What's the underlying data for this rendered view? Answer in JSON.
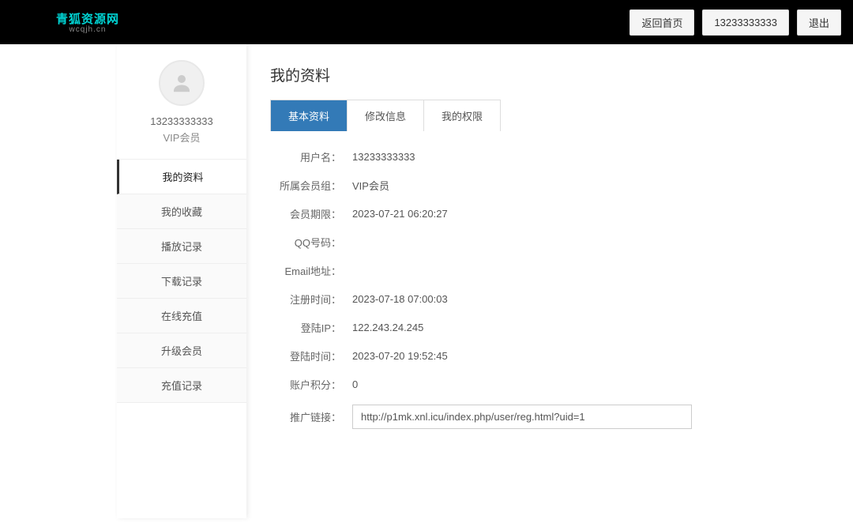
{
  "header": {
    "logo_top": "青狐资源网",
    "logo_bottom": "wcqjh.cn",
    "buttons": {
      "home": "返回首页",
      "user": "13233333333",
      "logout": "退出"
    }
  },
  "sidebar": {
    "username": "13233333333",
    "user_level": "VIP会员",
    "nav": [
      {
        "label": "我的资料",
        "active": true
      },
      {
        "label": "我的收藏",
        "active": false
      },
      {
        "label": "播放记录",
        "active": false
      },
      {
        "label": "下载记录",
        "active": false
      },
      {
        "label": "在线充值",
        "active": false
      },
      {
        "label": "升级会员",
        "active": false
      },
      {
        "label": "充值记录",
        "active": false
      }
    ]
  },
  "main": {
    "title": "我的资料",
    "tabs": [
      {
        "label": "基本资料",
        "active": true
      },
      {
        "label": "修改信息",
        "active": false
      },
      {
        "label": "我的权限",
        "active": false
      }
    ],
    "fields": {
      "username_label": "用户名：",
      "username_value": "13233333333",
      "group_label": "所属会员组：",
      "group_value": "VIP会员",
      "expire_label": "会员期限：",
      "expire_value": "2023-07-21 06:20:27",
      "qq_label": "QQ号码：",
      "qq_value": "",
      "email_label": "Email地址：",
      "email_value": "",
      "regtime_label": "注册时间：",
      "regtime_value": "2023-07-18 07:00:03",
      "loginip_label": "登陆IP：",
      "loginip_value": "122.243.24.245",
      "logintime_label": "登陆时间：",
      "logintime_value": "2023-07-20 19:52:45",
      "points_label": "账户积分：",
      "points_value": "0",
      "reflink_label": "推广链接：",
      "reflink_value": "http://p1mk.xnl.icu/index.php/user/reg.html?uid=1"
    }
  }
}
